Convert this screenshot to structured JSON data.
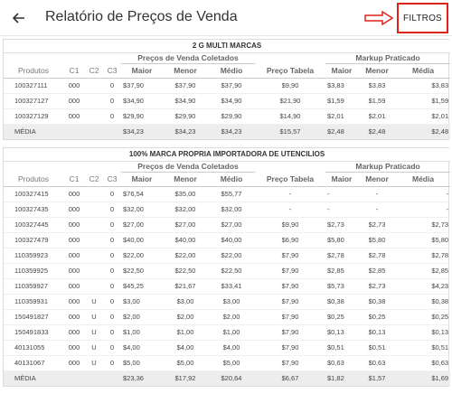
{
  "header": {
    "title": "Relatório de Preços de Venda",
    "filter_label": "FILTROS"
  },
  "columns": {
    "produtos": "Produtos",
    "c1": "C1",
    "c2": "C2",
    "c3": "C3",
    "coletados": "Preços de Venda Coletados",
    "maior": "Maior",
    "menor": "Menor",
    "medio": "Médio",
    "tabela": "Preço Tabela",
    "markup": "Markup Praticado",
    "m_maior": "Maior",
    "m_menor": "Menor",
    "m_media": "Média"
  },
  "sections": [
    {
      "title": "2 G MULTI MARCAS",
      "rows": [
        [
          "100327111",
          "000",
          "",
          "0",
          "$37,90",
          "$37,90",
          "$37,90",
          "$9,90",
          "$3,83",
          "$3,83",
          "$3,83"
        ],
        [
          "100327127",
          "000",
          "",
          "0",
          "$34,90",
          "$34,90",
          "$34,90",
          "$21,90",
          "$1,59",
          "$1,59",
          "$1,59"
        ],
        [
          "100327129",
          "000",
          "",
          "0",
          "$29,90",
          "$29,90",
          "$29,90",
          "$14,90",
          "$2,01",
          "$2,01",
          "$2,01"
        ]
      ],
      "media": [
        "MÉDIA",
        "",
        "",
        "",
        "$34,23",
        "$34,23",
        "$34,23",
        "$15,57",
        "$2,48",
        "$2,48",
        "$2,48"
      ]
    },
    {
      "title": "100% MARCA PROPRIA IMPORTADORA DE UTENCILIOS",
      "rows": [
        [
          "100327415",
          "000",
          "",
          "0",
          "$76,54",
          "$35,00",
          "$55,77",
          "-",
          "-",
          "-",
          "-"
        ],
        [
          "100327435",
          "000",
          "",
          "0",
          "$32,00",
          "$32,00",
          "$32,00",
          "-",
          "-",
          "-",
          "-"
        ],
        [
          "100327445",
          "000",
          "",
          "0",
          "$27,00",
          "$27,00",
          "$27,00",
          "$9,90",
          "$2,73",
          "$2,73",
          "$2,73"
        ],
        [
          "100327479",
          "000",
          "",
          "0",
          "$40,00",
          "$40,00",
          "$40,00",
          "$6,90",
          "$5,80",
          "$5,80",
          "$5,80"
        ],
        [
          "110359923",
          "000",
          "",
          "0",
          "$22,00",
          "$22,00",
          "$22,00",
          "$7,90",
          "$2,78",
          "$2,78",
          "$2,78"
        ],
        [
          "110359925",
          "000",
          "",
          "0",
          "$22,50",
          "$22,50",
          "$22,50",
          "$7,90",
          "$2,85",
          "$2,85",
          "$2,85"
        ],
        [
          "110359927",
          "000",
          "",
          "0",
          "$45,25",
          "$21,67",
          "$33,41",
          "$7,90",
          "$5,73",
          "$2,73",
          "$4,23"
        ],
        [
          "110359931",
          "000",
          "U",
          "0",
          "$3,00",
          "$3,00",
          "$3,00",
          "$7,90",
          "$0,38",
          "$0,38",
          "$0,38"
        ],
        [
          "150491827",
          "000",
          "U",
          "0",
          "$2,00",
          "$2,00",
          "$2,00",
          "$7,90",
          "$0,25",
          "$0,25",
          "$0,25"
        ],
        [
          "150491833",
          "000",
          "U",
          "0",
          "$1,00",
          "$1,00",
          "$1,00",
          "$7,90",
          "$0,13",
          "$0,13",
          "$0,13"
        ],
        [
          "40131055",
          "000",
          "U",
          "0",
          "$4,00",
          "$4,00",
          "$4,00",
          "$7,90",
          "$0,51",
          "$0,51",
          "$0,51"
        ],
        [
          "40131067",
          "000",
          "U",
          "0",
          "$5,00",
          "$5,00",
          "$5,00",
          "$7,90",
          "$0,63",
          "$0,63",
          "$0,63"
        ]
      ],
      "media": [
        "MÉDIA",
        "",
        "",
        "",
        "$23,36",
        "$17,92",
        "$20,64",
        "$6,67",
        "$1,82",
        "$1,57",
        "$1,69"
      ]
    }
  ]
}
